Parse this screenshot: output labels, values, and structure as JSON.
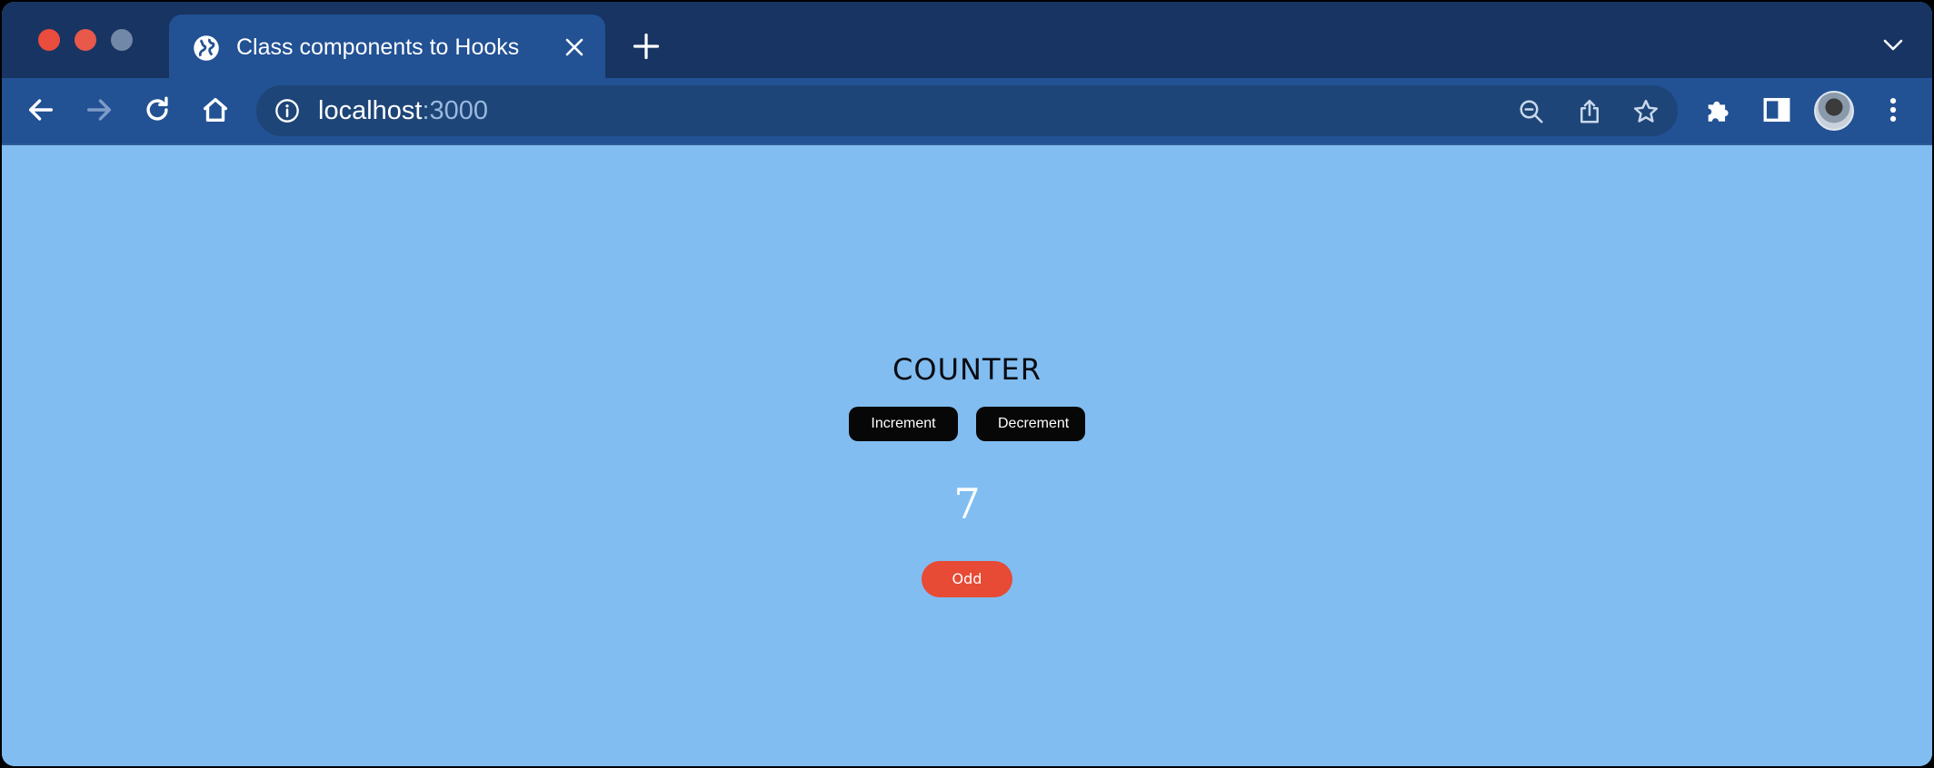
{
  "browser": {
    "tab": {
      "title": "Class components to Hooks"
    },
    "address_bar": {
      "host": "localhost",
      "port": ":3000"
    }
  },
  "app": {
    "title": "COUNTER",
    "buttons": {
      "increment": "Increment",
      "decrement": "Decrement"
    },
    "count": "7",
    "parity": "Odd"
  },
  "colors": {
    "page_background": "#81bdf0",
    "button_background": "#070707",
    "parity_badge": "#e74a35",
    "tab_strip": "#173462",
    "toolbar": "#225194"
  },
  "icons": [
    "globe-icon",
    "close-icon",
    "plus-icon",
    "chevron-down-icon",
    "back-arrow-icon",
    "forward-arrow-icon",
    "reload-icon",
    "home-icon",
    "info-icon",
    "zoom-out-icon",
    "share-icon",
    "star-icon",
    "puzzle-icon",
    "side-panel-icon",
    "kebab-menu-icon"
  ]
}
